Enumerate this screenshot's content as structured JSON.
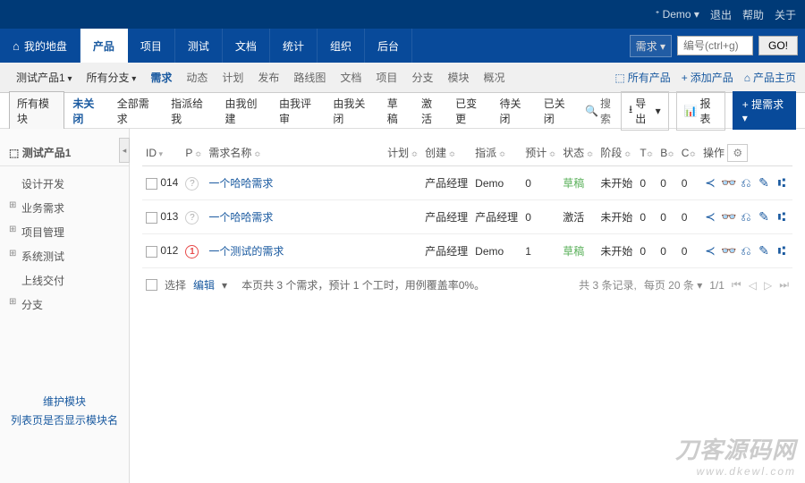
{
  "topbar": {
    "user_icon": "ᕀ",
    "user": "Demo",
    "logout": "退出",
    "help": "帮助",
    "about": "关于"
  },
  "mainnav": {
    "items": [
      {
        "label": "我的地盘",
        "icon": "⌂"
      },
      {
        "label": "产品",
        "active": true
      },
      {
        "label": "项目"
      },
      {
        "label": "测试"
      },
      {
        "label": "文档"
      },
      {
        "label": "统计"
      },
      {
        "label": "组织"
      },
      {
        "label": "后台"
      }
    ],
    "search_type": "需求",
    "search_placeholder": "编号(ctrl+g)",
    "go": "GO!"
  },
  "subnav": {
    "product_sel": "测试产品1",
    "branch_sel": "所有分支",
    "links": [
      "需求",
      "动态",
      "计划",
      "发布",
      "路线图",
      "文档",
      "项目",
      "分支",
      "模块",
      "概况"
    ],
    "active_index": 0,
    "right": {
      "all_products": "所有产品",
      "add_product": "添加产品",
      "product_home": "产品主页"
    }
  },
  "filterbar": {
    "all_modules": "所有模块",
    "filters": [
      "未关闭",
      "全部需求",
      "指派给我",
      "由我创建",
      "由我评审",
      "由我关闭",
      "草稿",
      "激活",
      "已变更",
      "待关闭",
      "已关闭"
    ],
    "active_index": 0,
    "search_label": "搜索",
    "export": "导出",
    "report": "报表",
    "submit": "提需求"
  },
  "sidebar": {
    "title": "测试产品1",
    "nodes": [
      {
        "label": "设计开发",
        "exp": false
      },
      {
        "label": "业务需求",
        "exp": true
      },
      {
        "label": "项目管理",
        "exp": true
      },
      {
        "label": "系统测试",
        "exp": true
      },
      {
        "label": "上线交付",
        "exp": false
      },
      {
        "label": "分支",
        "exp": true
      }
    ],
    "maintain": "维护模块",
    "show_module_name": "列表页是否显示模块名"
  },
  "table": {
    "headers": {
      "id": "ID",
      "p": "P",
      "name": "需求名称",
      "plan": "计划",
      "create": "创建",
      "assign": "指派",
      "est": "预计",
      "status": "状态",
      "stage": "阶段",
      "t": "T",
      "b": "B",
      "c": "C",
      "actions": "操作"
    },
    "rows": [
      {
        "id": "014",
        "pri": "q",
        "pri_label": "?",
        "name": "一个哈哈需求",
        "plan": "",
        "create": "产品经理",
        "assign": "Demo",
        "est": "0",
        "status": "草稿",
        "status_cls": "draft",
        "stage": "未开始",
        "t": "0",
        "b": "0",
        "c": "0"
      },
      {
        "id": "013",
        "pri": "q",
        "pri_label": "?",
        "name": "一个哈哈需求",
        "plan": "",
        "create": "产品经理",
        "assign": "产品经理",
        "est": "0",
        "status": "激活",
        "status_cls": "",
        "stage": "未开始",
        "t": "0",
        "b": "0",
        "c": "0"
      },
      {
        "id": "012",
        "pri": "1",
        "pri_label": "1",
        "name": "一个测试的需求",
        "plan": "",
        "create": "产品经理",
        "assign": "Demo",
        "est": "1",
        "status": "草稿",
        "status_cls": "draft",
        "stage": "未开始",
        "t": "0",
        "b": "0",
        "c": "0"
      }
    ]
  },
  "footer": {
    "select": "选择",
    "edit": "编辑",
    "summary": "本页共 3 个需求，预计 1 个工时，用例覆盖率0%。",
    "total": "共 3 条记录,",
    "per_page": "每页 20 条",
    "page": "1/1"
  },
  "watermark": {
    "l1": "刀客源码网",
    "l2": "www.dkewl.com"
  }
}
